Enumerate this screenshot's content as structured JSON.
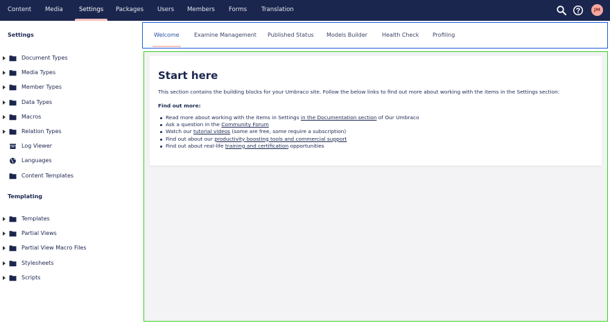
{
  "top_nav": {
    "items": [
      "Content",
      "Media",
      "Settings",
      "Packages",
      "Users",
      "Members",
      "Forms",
      "Translation"
    ],
    "active": "Settings",
    "avatar_initials": "JM",
    "icons": [
      "search-icon",
      "help-icon"
    ]
  },
  "sidebar": {
    "settings_heading": "Settings",
    "settings_items": [
      {
        "label": "Document Types",
        "icon": "folder-icon",
        "expandable": true
      },
      {
        "label": "Media Types",
        "icon": "folder-icon",
        "expandable": true
      },
      {
        "label": "Member Types",
        "icon": "folder-icon",
        "expandable": true
      },
      {
        "label": "Data Types",
        "icon": "folder-icon",
        "expandable": true
      },
      {
        "label": "Macros",
        "icon": "folder-icon",
        "expandable": true
      },
      {
        "label": "Relation Types",
        "icon": "folder-icon",
        "expandable": true
      },
      {
        "label": "Log Viewer",
        "icon": "log-viewer-icon",
        "expandable": false
      },
      {
        "label": "Languages",
        "icon": "globe-icon",
        "expandable": false
      },
      {
        "label": "Content Templates",
        "icon": "folder-icon",
        "expandable": false
      }
    ],
    "templating_heading": "Templating",
    "templating_items": [
      {
        "label": "Templates",
        "icon": "folder-icon",
        "expandable": true
      },
      {
        "label": "Partial Views",
        "icon": "folder-icon",
        "expandable": true
      },
      {
        "label": "Partial View Macro Files",
        "icon": "folder-icon",
        "expandable": true
      },
      {
        "label": "Stylesheets",
        "icon": "folder-icon",
        "expandable": true
      },
      {
        "label": "Scripts",
        "icon": "folder-icon",
        "expandable": true
      }
    ]
  },
  "tabs": {
    "items": [
      "Welcome",
      "Examine Management",
      "Published Status",
      "Models Builder",
      "Health Check",
      "Profiling"
    ],
    "active": "Welcome"
  },
  "welcome": {
    "title": "Start here",
    "intro": "This section contains the building blocks for your Umbraco site. Follow the below links to find out more about working with the items in the Settings section:",
    "find_out_more": "Find out more:",
    "bullets": [
      {
        "before": "Read more about working with the items in Settings ",
        "link": "in the Documentation section",
        "after": " of Our Umbraco"
      },
      {
        "before": "Ask a question in the ",
        "link": "Community Forum",
        "after": ""
      },
      {
        "before": "Watch our ",
        "link": "tutorial videos",
        "after": " (some are free, some require a subscription)"
      },
      {
        "before": "Find out about our ",
        "link": "productivity boosting tools and commercial support",
        "after": ""
      },
      {
        "before": "Find out about real-life ",
        "link": "training and certification",
        "after": " opportunities"
      }
    ]
  },
  "colors": {
    "header_bg": "#1b264f",
    "active_indicator": "#f5c1bc",
    "tab_active_text": "#2152a3",
    "content_bg": "#f3f3f5"
  }
}
